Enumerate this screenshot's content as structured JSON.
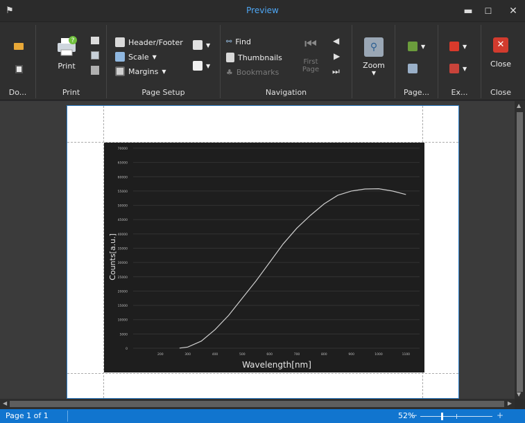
{
  "window": {
    "title": "Preview",
    "minimize": "▬",
    "maximize": "☐",
    "close": "✕"
  },
  "ribbon": {
    "document_group": {
      "label": "Do..."
    },
    "print_group": {
      "label": "Print",
      "print_button": "Print"
    },
    "page_setup_group": {
      "label": "Page Setup",
      "header_footer": "Header/Footer",
      "scale": "Scale",
      "margins": "Margins"
    },
    "navigation_group": {
      "label": "Navigation",
      "find": "Find",
      "thumbnails": "Thumbnails",
      "bookmarks": "Bookmarks",
      "first_page_line1": "First",
      "first_page_line2": "Page"
    },
    "zoom_group": {
      "zoom_button": "Zoom"
    },
    "page_background_group": {
      "label": "Page..."
    },
    "export_group": {
      "label": "Ex..."
    },
    "close_group": {
      "label": "Close",
      "close_button": "Close"
    }
  },
  "status": {
    "page_info": "Page 1 of 1",
    "zoom": "52%",
    "zoom_level_fraction": 0.3
  },
  "chart_data": {
    "type": "line",
    "title": "",
    "xlabel": "Wavelength[nm]",
    "ylabel": "Counts[a.u.]",
    "xlim": [
      100,
      1150
    ],
    "ylim": [
      0,
      70000
    ],
    "x_ticks": [
      200,
      300,
      400,
      500,
      600,
      700,
      800,
      900,
      1000,
      1100
    ],
    "y_ticks": [
      0,
      5000,
      10000,
      15000,
      20000,
      25000,
      30000,
      35000,
      40000,
      45000,
      50000,
      55000,
      60000,
      65000,
      70000
    ],
    "grid": true,
    "series": [
      {
        "x": [
          270,
          300,
          350,
          400,
          450,
          500,
          550,
          600,
          650,
          700,
          750,
          800,
          850,
          900,
          950,
          1000,
          1050,
          1100
        ],
        "y": [
          50,
          400,
          2500,
          6500,
          11500,
          17500,
          23500,
          30000,
          36500,
          42000,
          46500,
          50500,
          53500,
          55000,
          55700,
          55800,
          55000,
          53800
        ]
      }
    ]
  }
}
